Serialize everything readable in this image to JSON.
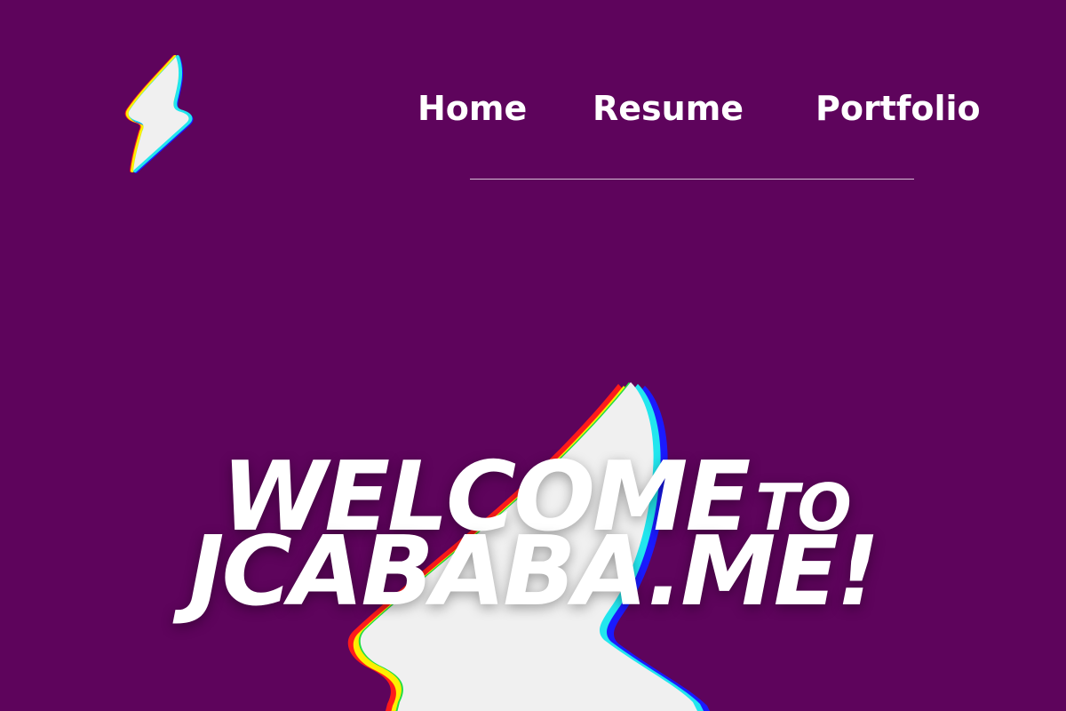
{
  "nav": {
    "items": [
      {
        "label": "Home"
      },
      {
        "label": "Resume"
      },
      {
        "label": "Portfolio"
      }
    ]
  },
  "hero": {
    "title_word_1": "WELCOME",
    "title_word_2": "TO",
    "title_line_2": "JCABABA.ME!"
  },
  "icons": {
    "logo": "lightning-bolt-icon",
    "hero_graphic": "lightning-bolt-icon"
  },
  "colors": {
    "background": "#5e045c",
    "text": "#ffffff",
    "bolt_fill": "#f0f0f0",
    "glitch_red": "#ff1a1a",
    "glitch_yellow": "#ffee00",
    "glitch_green": "#22dd44",
    "glitch_cyan": "#22e6ee",
    "glitch_blue": "#1a1aff"
  }
}
